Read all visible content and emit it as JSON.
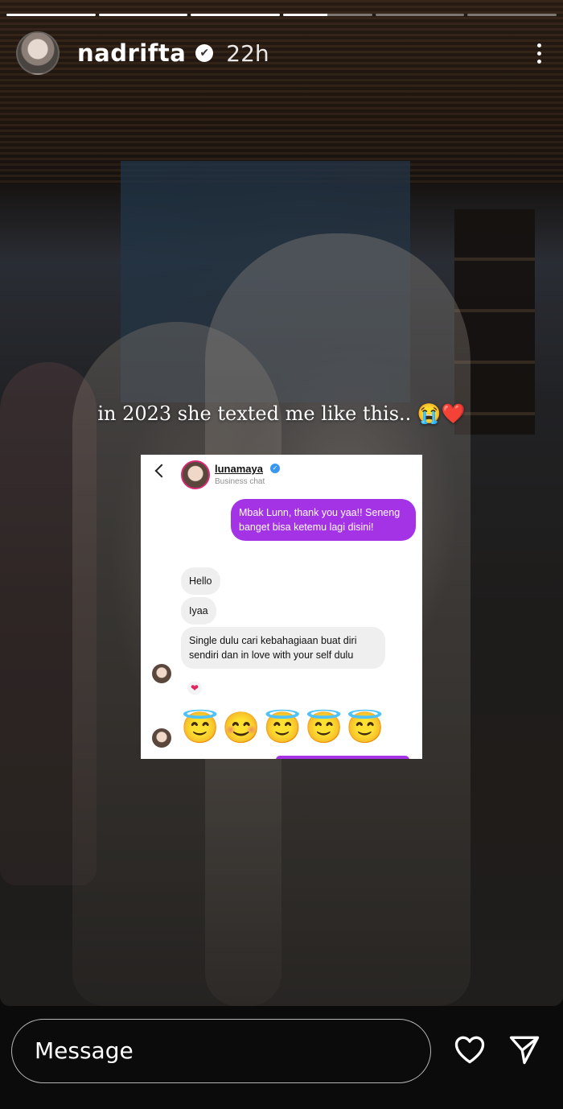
{
  "story": {
    "progress_segments": [
      1,
      1,
      1,
      0.5,
      0,
      0
    ],
    "user": {
      "username": "nadrifta",
      "verified_glyph": "✔",
      "time": "22h"
    },
    "more_icon": "more-vertical-icon",
    "caption": "in 2023 she texted me like this.. 😭❤️"
  },
  "chat_screenshot": {
    "contact_name": "lunamaya",
    "verified_glyph": "✓",
    "subtitle": "Business chat",
    "outgoing": "Mbak Lunn, thank you yaa!! Seneng banget bisa ketemu lagi disini!",
    "incoming": [
      "Hello",
      "Iyaa",
      "Single dulu cari kebahagiaan buat diri sendiri dan in love with your self dulu"
    ],
    "reaction": "❤",
    "emoji_row": "😇😊😇😇😇"
  },
  "reply_bar": {
    "placeholder": "Message",
    "like_icon": "heart-icon",
    "send_icon": "send-icon"
  }
}
